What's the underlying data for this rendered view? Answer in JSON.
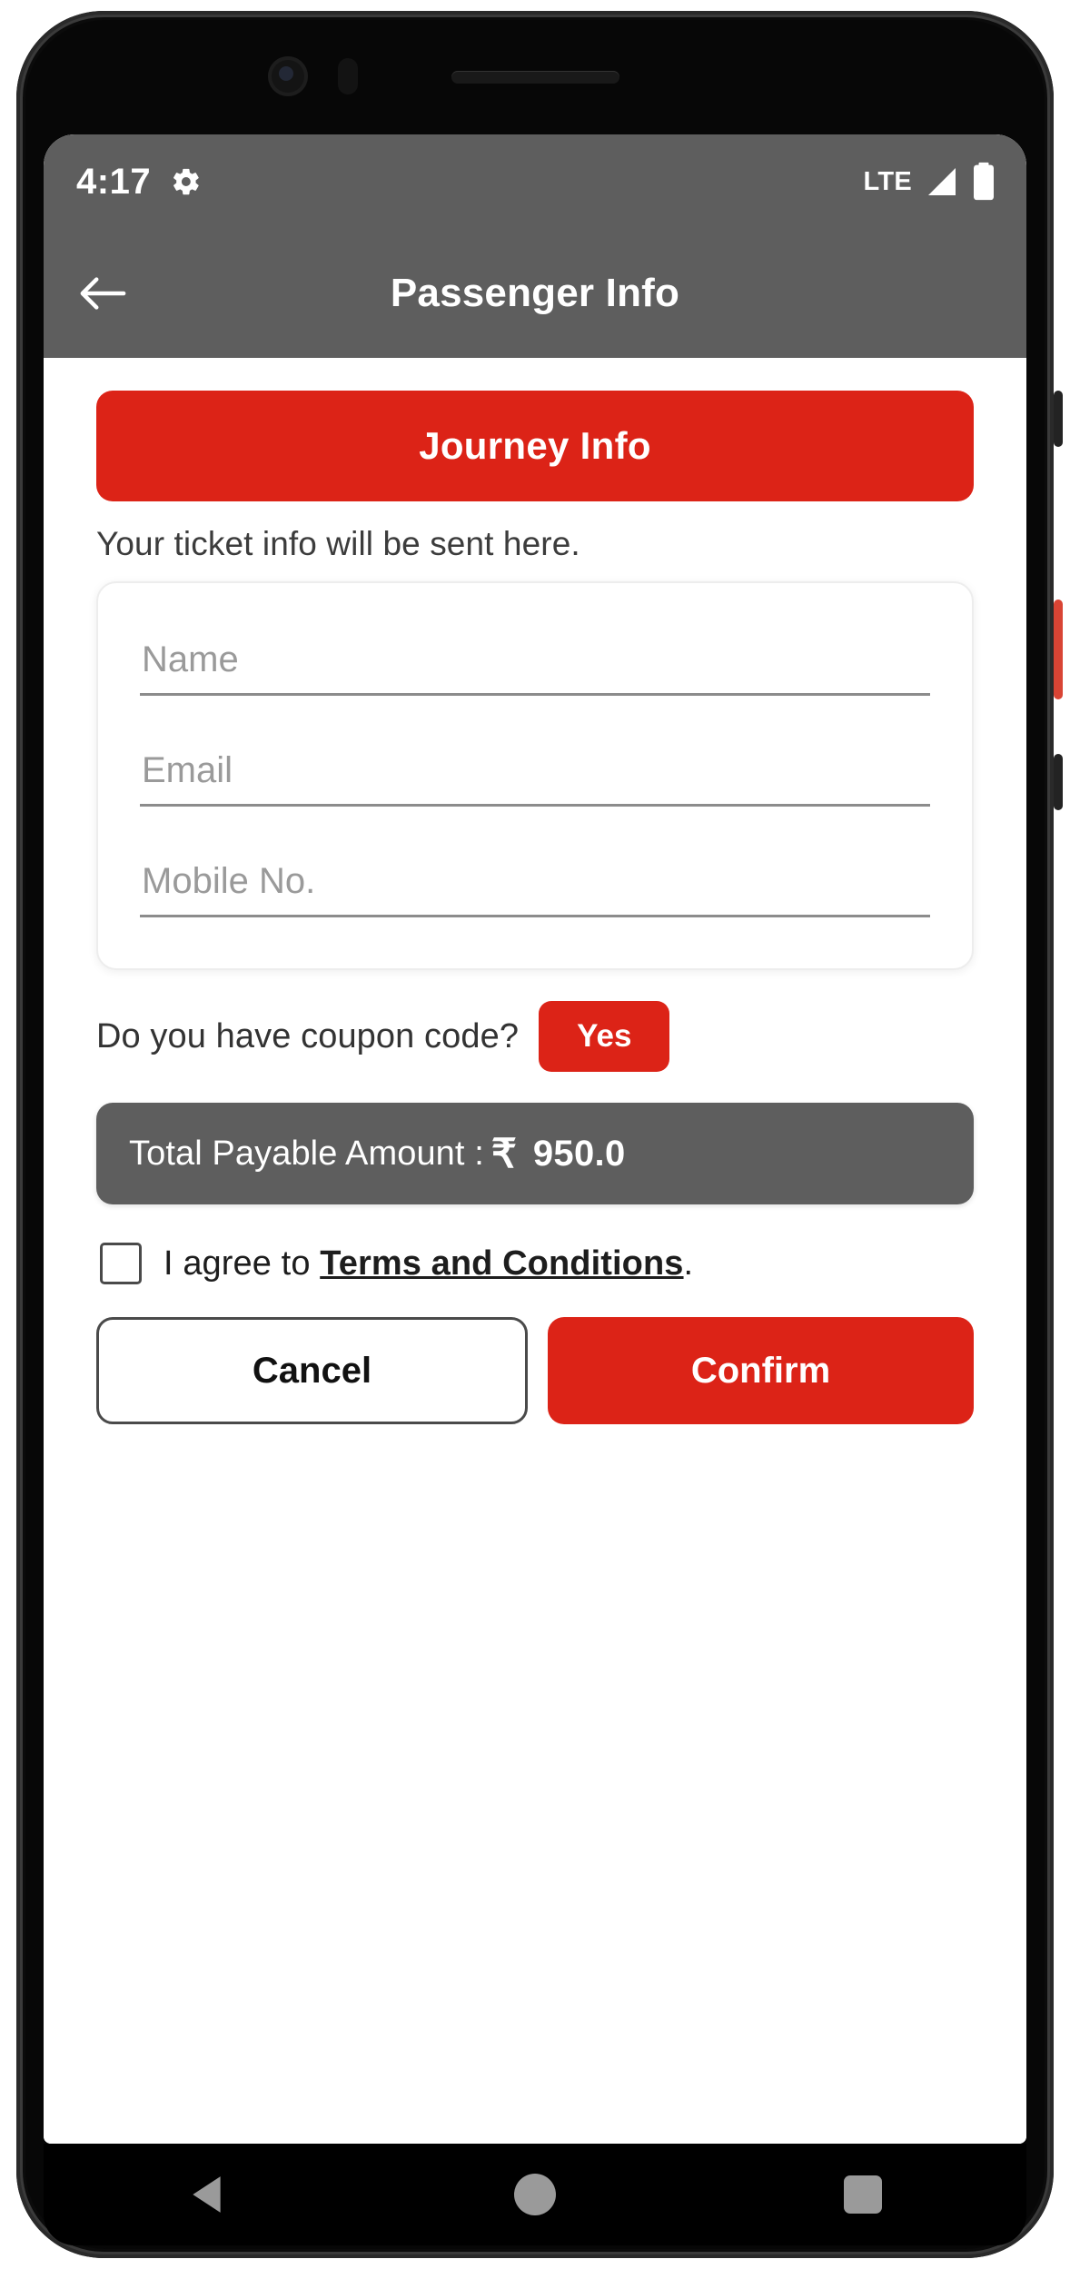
{
  "status_bar": {
    "clock": "4:17",
    "gear_icon": "gear-icon",
    "network_label": "LTE",
    "signal_icon": "signal-bars-icon",
    "battery_icon": "battery-icon"
  },
  "app_bar": {
    "back_icon": "back-arrow-icon",
    "title": "Passenger Info"
  },
  "main": {
    "journey_button": "Journey Info",
    "ticket_note": "Your ticket info will be sent here.",
    "fields": [
      {
        "name": "name",
        "placeholder": "Name",
        "value": ""
      },
      {
        "name": "email",
        "placeholder": "Email",
        "value": ""
      },
      {
        "name": "mobile",
        "placeholder": "Mobile No.",
        "value": ""
      }
    ],
    "coupon": {
      "question": "Do you have coupon code?",
      "yes_label": "Yes"
    },
    "total": {
      "label": "Total Payable Amount :",
      "currency_symbol": "₹",
      "amount": "950.0"
    },
    "terms": {
      "checked": false,
      "prefix": "I agree to ",
      "link": "Terms and Conditions",
      "suffix": "."
    },
    "actions": {
      "cancel": "Cancel",
      "confirm": "Confirm"
    }
  },
  "nav_bar": {
    "back_icon": "nav-back-triangle-icon",
    "home_icon": "nav-home-circle-icon",
    "recents_icon": "nav-recents-square-icon"
  },
  "colors": {
    "accent_red": "#dc2317",
    "header_gray": "#5e5e5e",
    "surface_white": "#ffffff",
    "nav_black": "#000000"
  }
}
